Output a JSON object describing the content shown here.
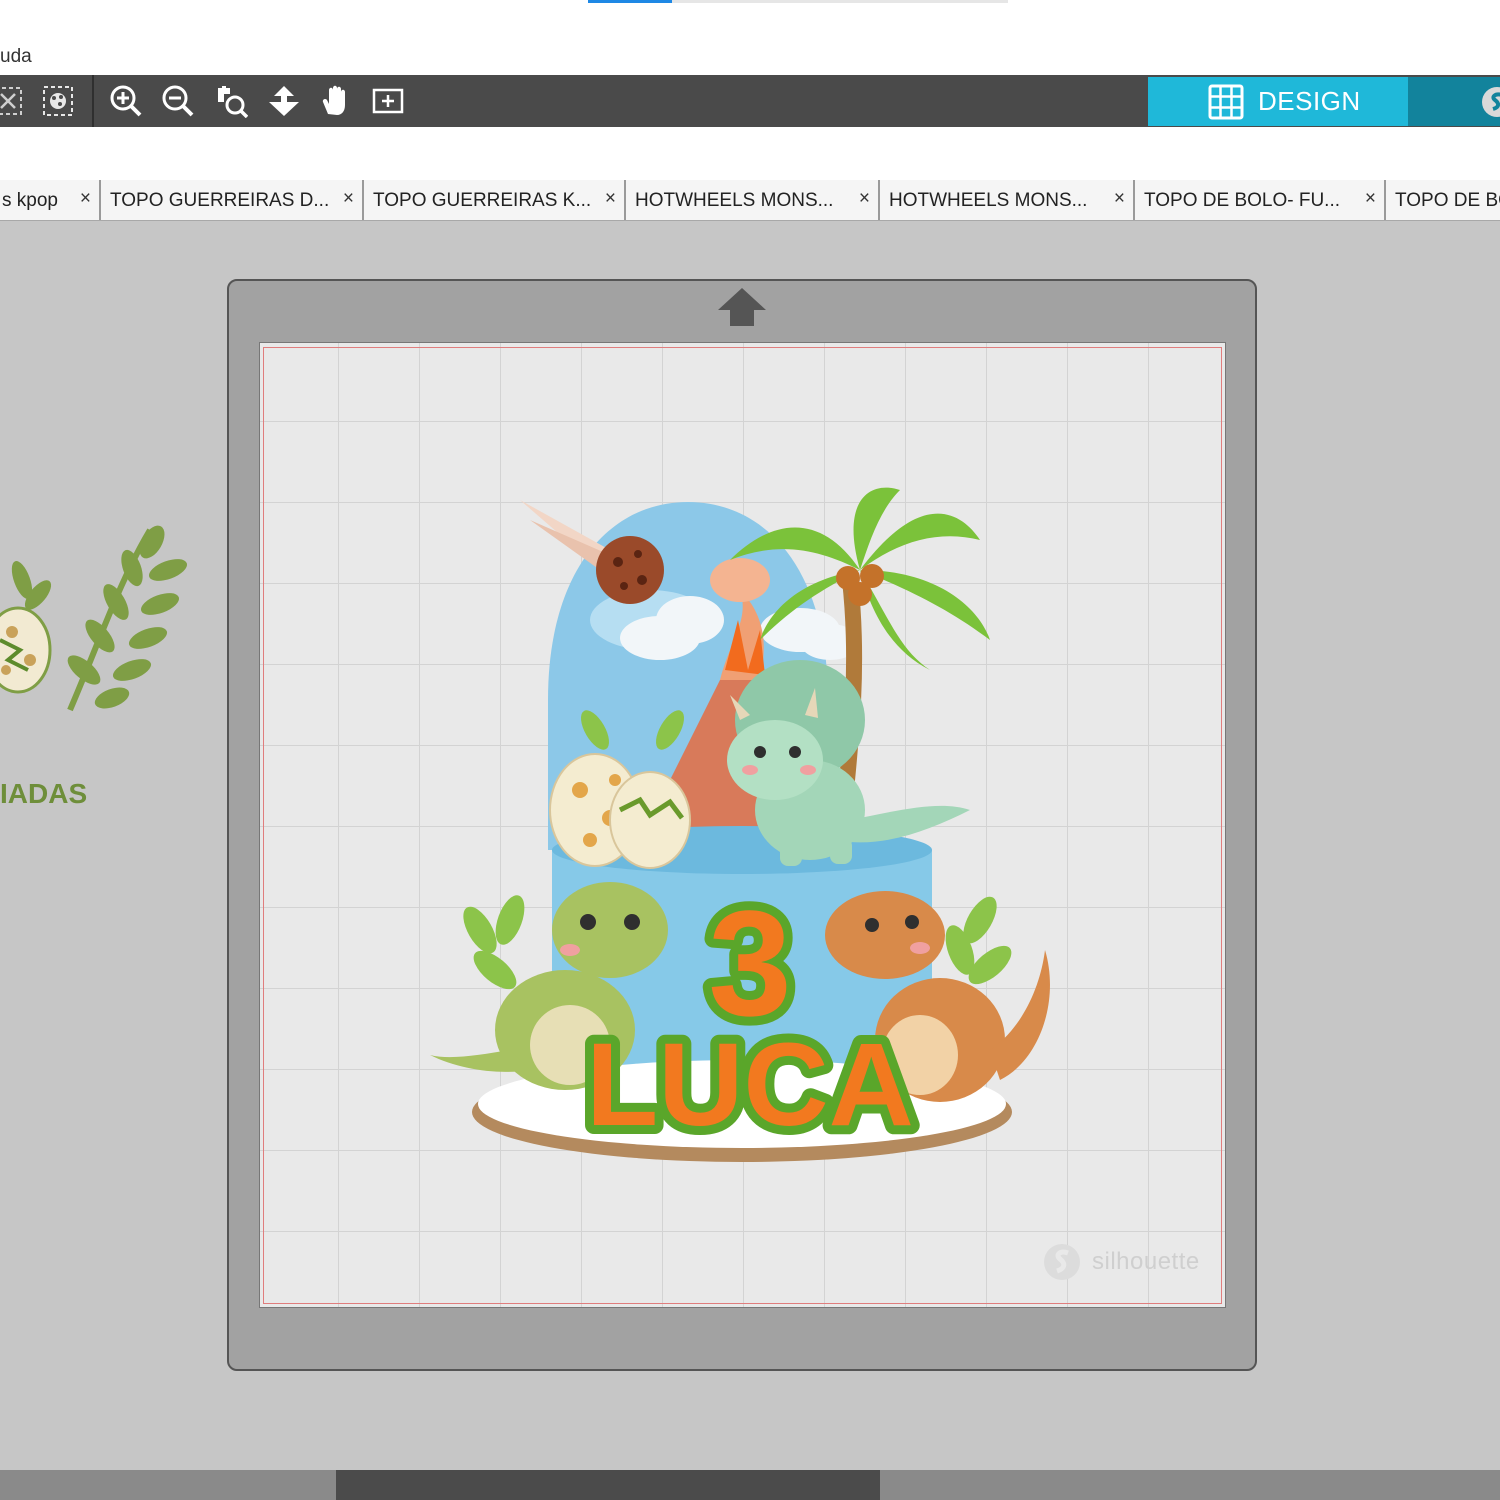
{
  "window": {
    "menu_fragment": "uda",
    "load_progress": 0.2
  },
  "toolbar": {
    "tools": [
      {
        "icon": "deselect-icon"
      },
      {
        "icon": "select-all-icon"
      },
      {
        "icon": "zoom-in-icon"
      },
      {
        "icon": "zoom-out-icon"
      },
      {
        "icon": "zoom-box-icon"
      },
      {
        "icon": "move-pan-icon"
      },
      {
        "icon": "hand-pan-icon"
      },
      {
        "icon": "fit-to-page-icon"
      }
    ],
    "design_label": "DESIGN"
  },
  "tabs": [
    {
      "label": "s kpop",
      "close": "×"
    },
    {
      "label": "TOPO GUERREIRAS D...",
      "close": "×"
    },
    {
      "label": "TOPO GUERREIRAS K...",
      "close": "×"
    },
    {
      "label": "HOTWHEELS MONS...",
      "close": "×"
    },
    {
      "label": "HOTWHEELS MONS...",
      "close": "×"
    },
    {
      "label": "TOPO DE BOLO- FU...",
      "close": "×"
    },
    {
      "label": "TOPO DE BO",
      "close": ""
    }
  ],
  "workspace": {
    "side_text": "IADAS",
    "watermark": "silhouette"
  },
  "artwork": {
    "number": "3",
    "name": "LUCA",
    "colors": {
      "orange": "#f2791f",
      "green": "#5aa62a",
      "sky": "#7ec8e6",
      "cake": "#86c9e8"
    }
  },
  "colors": {
    "toolbar": "#4a4a4a",
    "design_accent": "#1fb8d9",
    "design_dark": "#12839c",
    "canvas": "#c6c6c6"
  }
}
